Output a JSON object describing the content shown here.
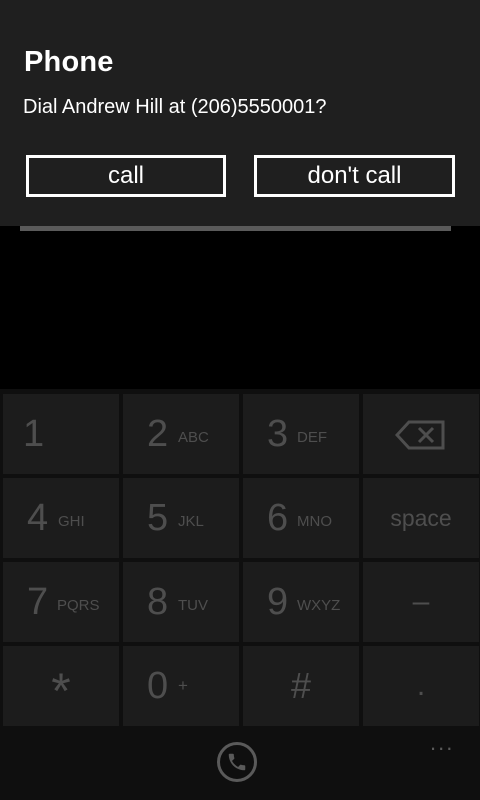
{
  "dialog": {
    "title": "Phone",
    "message": "Dial Andrew Hill at (206)5550001?",
    "call_label": "call",
    "dont_call_label": "don't call"
  },
  "keypad": {
    "keys": [
      {
        "digit": "1",
        "letters": ""
      },
      {
        "digit": "2",
        "letters": "ABC"
      },
      {
        "digit": "3",
        "letters": "DEF"
      },
      {
        "icon": "backspace-icon"
      },
      {
        "digit": "4",
        "letters": "GHI"
      },
      {
        "digit": "5",
        "letters": "JKL"
      },
      {
        "digit": "6",
        "letters": "MNO"
      },
      {
        "word": "space"
      },
      {
        "digit": "7",
        "letters": "PQRS"
      },
      {
        "digit": "8",
        "letters": "TUV"
      },
      {
        "digit": "9",
        "letters": "WXYZ"
      },
      {
        "symbol": "–"
      },
      {
        "symbol": "*"
      },
      {
        "digit": "0",
        "letters": "+"
      },
      {
        "symbol": "#"
      },
      {
        "symbol": "."
      }
    ]
  },
  "appbar": {
    "icon": "phone-icon",
    "more": "..."
  },
  "colors": {
    "dialog_bg": "#1f1f1f",
    "key_bg": "#1c1c1c",
    "key_text": "#4e4e4e"
  }
}
